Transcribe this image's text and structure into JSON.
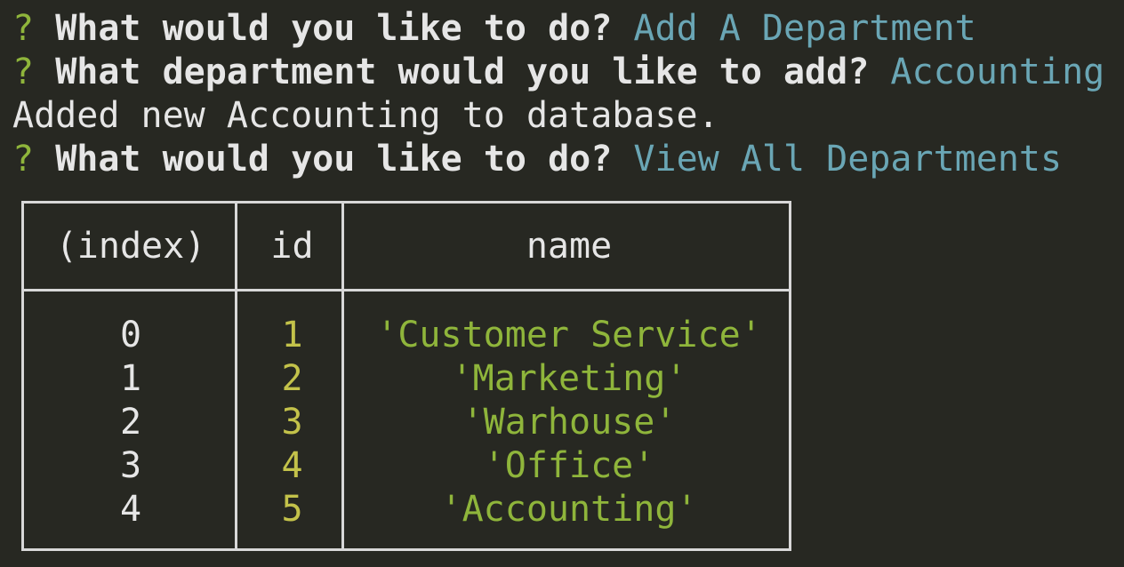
{
  "terminal": {
    "lines": [
      {
        "prompt": "?",
        "question": "What would you like to do?",
        "answer": "Add A Department"
      },
      {
        "prompt": "?",
        "question": "What department would you like to add?",
        "answer": "Accounting"
      },
      {
        "message": "Added new Accounting to database."
      },
      {
        "prompt": "?",
        "question": "What would you like to do?",
        "answer": "View All Departments"
      }
    ]
  },
  "table": {
    "headers": [
      "(index)",
      "id",
      "name"
    ],
    "rows": [
      {
        "index": "0",
        "id": "1",
        "name": "'Customer Service'"
      },
      {
        "index": "1",
        "id": "2",
        "name": "'Marketing'"
      },
      {
        "index": "2",
        "id": "3",
        "name": "'Warhouse'"
      },
      {
        "index": "3",
        "id": "4",
        "name": "'Office'"
      },
      {
        "index": "4",
        "id": "5",
        "name": "'Accounting'"
      }
    ]
  },
  "colors": {
    "background": "#272822",
    "prompt": "#8fb53b",
    "answer": "#6aa6b5",
    "id_value": "#c3c24a",
    "string_value": "#8fb53b",
    "text": "#e6e6e6"
  }
}
